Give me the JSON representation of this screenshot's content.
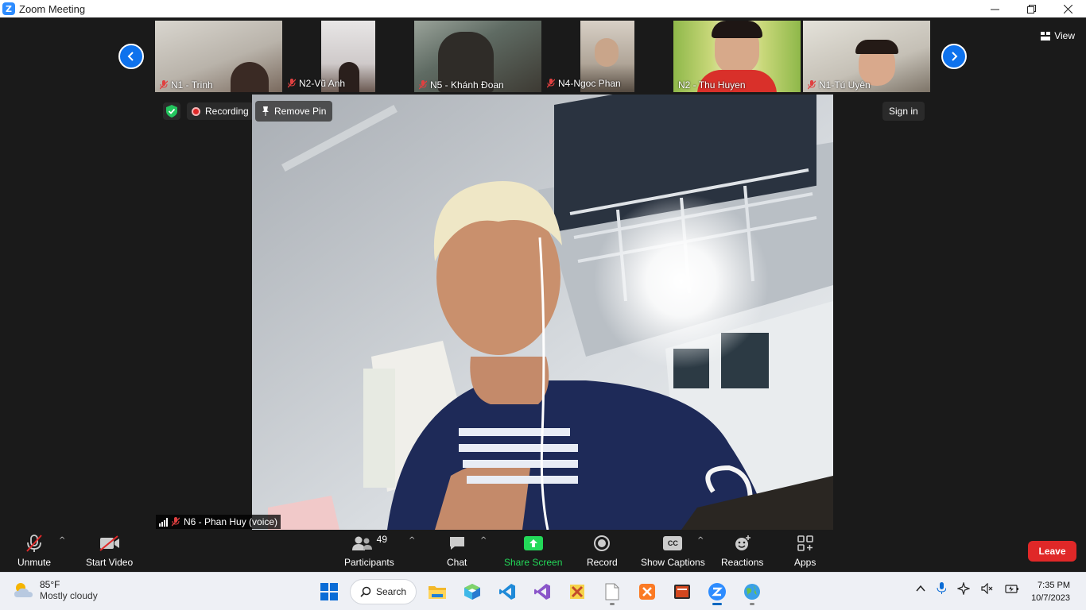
{
  "window": {
    "title": "Zoom Meeting"
  },
  "gallery": {
    "participants": [
      {
        "name": "N1 - Trinh",
        "muted": true
      },
      {
        "name": "N2-Vũ Anh",
        "muted": true
      },
      {
        "name": "N5 -  Khánh Đoan",
        "muted": true
      },
      {
        "name": "N4-Ngoc Phan",
        "muted": true
      },
      {
        "name": "N2 - Thu Huyen",
        "muted": false
      },
      {
        "name": "N1-Tú Uyên",
        "muted": true
      }
    ]
  },
  "view_button": {
    "label": "View"
  },
  "status": {
    "recording_label": "Recording",
    "remove_pin_label": "Remove Pin",
    "sign_in_label": "Sign in"
  },
  "active_speaker": {
    "name": "N6 - Phan Huy (voice)"
  },
  "toolbar": {
    "unmute_label": "Unmute",
    "start_video_label": "Start Video",
    "participants_label": "Participants",
    "participants_count": "49",
    "chat_label": "Chat",
    "share_screen_label": "Share Screen",
    "record_label": "Record",
    "show_captions_label": "Show Captions",
    "captions_badge": "CC",
    "reactions_label": "Reactions",
    "apps_label": "Apps",
    "leave_label": "Leave"
  },
  "taskbar": {
    "weather_temp": "85°F",
    "weather_desc": "Mostly cloudy",
    "search_label": "Search",
    "time": "7:35 PM",
    "date": "10/7/2023"
  },
  "colors": {
    "zoom_blue": "#0e72ed",
    "leave_red": "#e02828",
    "share_green": "#23d959"
  }
}
